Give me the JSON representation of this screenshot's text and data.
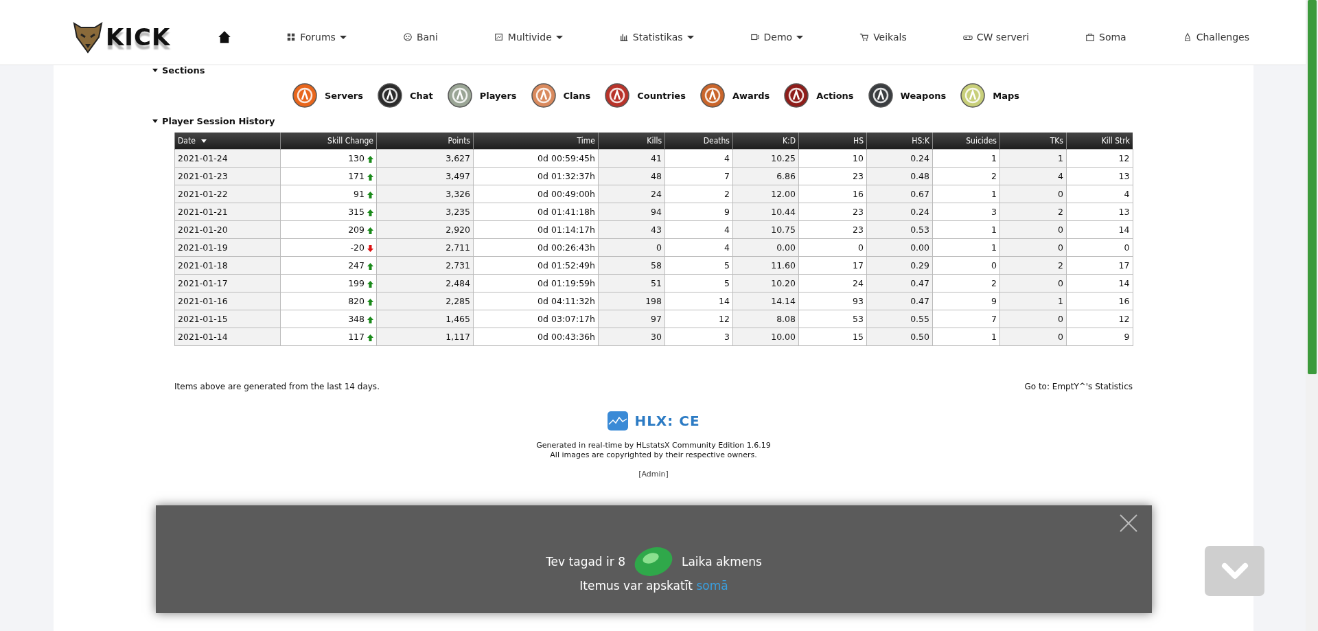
{
  "logo": {
    "text": "KICK"
  },
  "nav": [
    {
      "kind": "home"
    },
    {
      "label": "Forums",
      "kind": "menu",
      "dropdown": true
    },
    {
      "label": "Bani",
      "kind": "menu",
      "dropdown": false
    },
    {
      "label": "Multivide",
      "kind": "menu",
      "dropdown": true
    },
    {
      "label": "Statistikas",
      "kind": "menu",
      "dropdown": true
    },
    {
      "label": "Demo",
      "kind": "menu",
      "dropdown": true
    },
    {
      "label": "Veikals",
      "kind": "menu",
      "dropdown": false
    },
    {
      "label": "CW serveri",
      "kind": "menu",
      "dropdown": false
    },
    {
      "label": "Soma",
      "kind": "menu",
      "dropdown": false
    },
    {
      "label": "Challenges",
      "kind": "menu",
      "dropdown": false
    }
  ],
  "sections": {
    "title": "Sections",
    "expanded": true,
    "items": [
      {
        "label": "Servers",
        "color": "#e8661c"
      },
      {
        "label": "Chat",
        "color": "#2b2b2b"
      },
      {
        "label": "Players",
        "color": "#9aa595"
      },
      {
        "label": "Clans",
        "color": "#d98a5e"
      },
      {
        "label": "Countries",
        "color": "#b8332a"
      },
      {
        "label": "Awards",
        "color": "#c9652b"
      },
      {
        "label": "Actions",
        "color": "#8e1d1a"
      },
      {
        "label": "Weapons",
        "color": "#3a3d40"
      },
      {
        "label": "Maps",
        "color": "#c8cf7a"
      }
    ]
  },
  "history": {
    "title": "Player Session History",
    "expanded": true,
    "columns": [
      {
        "label": "Date",
        "sorted": true
      },
      {
        "label": "Skill Change",
        "sorted": false
      },
      {
        "label": "Points",
        "sorted": false
      },
      {
        "label": "Time",
        "sorted": false
      },
      {
        "label": "Kills",
        "sorted": false
      },
      {
        "label": "Deaths",
        "sorted": false
      },
      {
        "label": "K:D",
        "sorted": false
      },
      {
        "label": "HS",
        "sorted": false
      },
      {
        "label": "HS:K",
        "sorted": false
      },
      {
        "label": "Suicides",
        "sorted": false
      },
      {
        "label": "TKs",
        "sorted": false
      },
      {
        "label": "Kill Strk",
        "sorted": false
      }
    ],
    "rows": [
      {
        "rising": true,
        "cells": [
          "2021-01-24",
          "130",
          "3,627",
          "0d 00:59:45h",
          "41",
          "4",
          "10.25",
          "10",
          "0.24",
          "1",
          "1",
          "12"
        ]
      },
      {
        "rising": true,
        "cells": [
          "2021-01-23",
          "171",
          "3,497",
          "0d 01:32:37h",
          "48",
          "7",
          "6.86",
          "23",
          "0.48",
          "2",
          "4",
          "13"
        ]
      },
      {
        "rising": true,
        "cells": [
          "2021-01-22",
          "91",
          "3,326",
          "0d 00:49:00h",
          "24",
          "2",
          "12.00",
          "16",
          "0.67",
          "1",
          "0",
          "4"
        ]
      },
      {
        "rising": true,
        "cells": [
          "2021-01-21",
          "315",
          "3,235",
          "0d 01:41:18h",
          "94",
          "9",
          "10.44",
          "23",
          "0.24",
          "3",
          "2",
          "13"
        ]
      },
      {
        "rising": true,
        "cells": [
          "2021-01-20",
          "209",
          "2,920",
          "0d 01:14:17h",
          "43",
          "4",
          "10.75",
          "23",
          "0.53",
          "1",
          "0",
          "14"
        ]
      },
      {
        "rising": false,
        "cells": [
          "2021-01-19",
          "-20",
          "2,711",
          "0d 00:26:43h",
          "0",
          "4",
          "0.00",
          "0",
          "0.00",
          "1",
          "0",
          "0"
        ]
      },
      {
        "rising": true,
        "cells": [
          "2021-01-18",
          "247",
          "2,731",
          "0d 01:52:49h",
          "58",
          "5",
          "11.60",
          "17",
          "0.29",
          "0",
          "2",
          "17"
        ]
      },
      {
        "rising": true,
        "cells": [
          "2021-01-17",
          "199",
          "2,484",
          "0d 01:19:59h",
          "51",
          "5",
          "10.20",
          "24",
          "0.47",
          "2",
          "0",
          "14"
        ]
      },
      {
        "rising": true,
        "cells": [
          "2021-01-16",
          "820",
          "2,285",
          "0d 04:11:32h",
          "198",
          "14",
          "14.14",
          "93",
          "0.47",
          "9",
          "1",
          "16"
        ]
      },
      {
        "rising": true,
        "cells": [
          "2021-01-15",
          "348",
          "1,465",
          "0d 03:07:17h",
          "97",
          "12",
          "8.08",
          "53",
          "0.55",
          "7",
          "0",
          "12"
        ]
      },
      {
        "rising": true,
        "cells": [
          "2021-01-14",
          "117",
          "1,117",
          "0d 00:43:36h",
          "30",
          "3",
          "10.00",
          "15",
          "0.50",
          "1",
          "0",
          "9"
        ]
      }
    ]
  },
  "notes": {
    "left": "Items above are generated from the last 14 days.",
    "right": "Go to: EmptY^'s Statistics"
  },
  "footer": {
    "logo_text": "HLX: CE",
    "lines": [
      "Generated in real-time by HLstatsX Community Edition 1.6.19",
      "All images are copyrighted by their respective owners."
    ],
    "admin": "[Admin]"
  },
  "popup": {
    "line1_before": "Tev tagad ir 8",
    "line1_after": "Laika akmens",
    "line2": "Itemus var apskatīt",
    "link": "somā"
  }
}
